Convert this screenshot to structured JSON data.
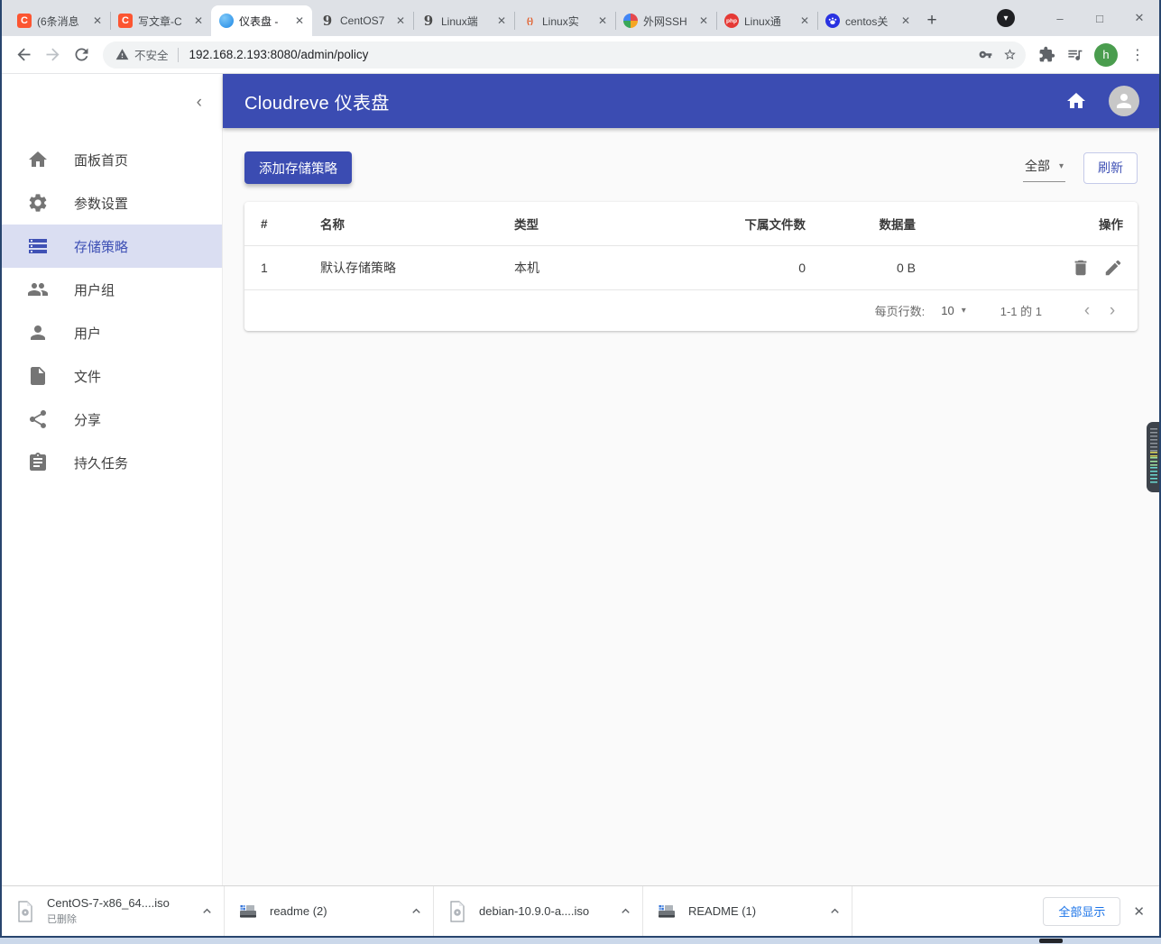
{
  "colors": {
    "accent": "#3b4cb2",
    "selected_bg": "#dadef2",
    "link_blue": "#1a73e8",
    "avatar_green": "#4a9d4e"
  },
  "browser": {
    "tabs": [
      {
        "title": "(6条消息",
        "fav_glyph": "C"
      },
      {
        "title": "写文章-C",
        "fav_glyph": "C"
      },
      {
        "title": "仪表盘 -",
        "fav_glyph": ""
      },
      {
        "title": "CentOS7",
        "fav_glyph": "9"
      },
      {
        "title": "Linux端",
        "fav_glyph": "9"
      },
      {
        "title": "Linux实",
        "fav_glyph": "(-)"
      },
      {
        "title": "外网SSH",
        "fav_glyph": ""
      },
      {
        "title": "Linux通",
        "fav_glyph": "php"
      },
      {
        "title": "centos关",
        "fav_glyph": ""
      }
    ],
    "address": {
      "security": "不安全",
      "url": "192.168.2.193:8080/admin/policy"
    },
    "profile_initial": "h"
  },
  "icons": {
    "close": "✕",
    "minimize": "–",
    "maximize": "□",
    "new_tab": "+",
    "kebab": "⋮",
    "caret_down": "▾",
    "collapse": "‹",
    "page_prev": "‹",
    "page_next": "›"
  },
  "app_header": {
    "title": "Cloudreve 仪表盘"
  },
  "sidebar": {
    "items": [
      {
        "label": "面板首页"
      },
      {
        "label": "参数设置"
      },
      {
        "label": "存储策略"
      },
      {
        "label": "用户组"
      },
      {
        "label": "用户"
      },
      {
        "label": "文件"
      },
      {
        "label": "分享"
      },
      {
        "label": "持久任务"
      }
    ]
  },
  "main": {
    "add_button": "添加存储策略",
    "filter_value": "全部",
    "refresh_label": "刷新",
    "table": {
      "headers": [
        "#",
        "名称",
        "类型",
        "下属文件数",
        "数据量",
        "操作"
      ],
      "rows": [
        {
          "num": "1",
          "name": "默认存储策略",
          "type": "本机",
          "files": "0",
          "size": "0 B"
        }
      ]
    },
    "pagination": {
      "rows_per_page_label": "每页行数:",
      "rows_per_page": "10",
      "range": "1-1 的 1"
    }
  },
  "downloads": {
    "items": [
      {
        "name": "CentOS-7-x86_64....iso",
        "status": "已删除"
      },
      {
        "name": "readme (2)",
        "status": ""
      },
      {
        "name": "debian-10.9.0-a....iso",
        "status": ""
      },
      {
        "name": "README (1)",
        "status": ""
      }
    ],
    "show_all": "全部显示"
  }
}
